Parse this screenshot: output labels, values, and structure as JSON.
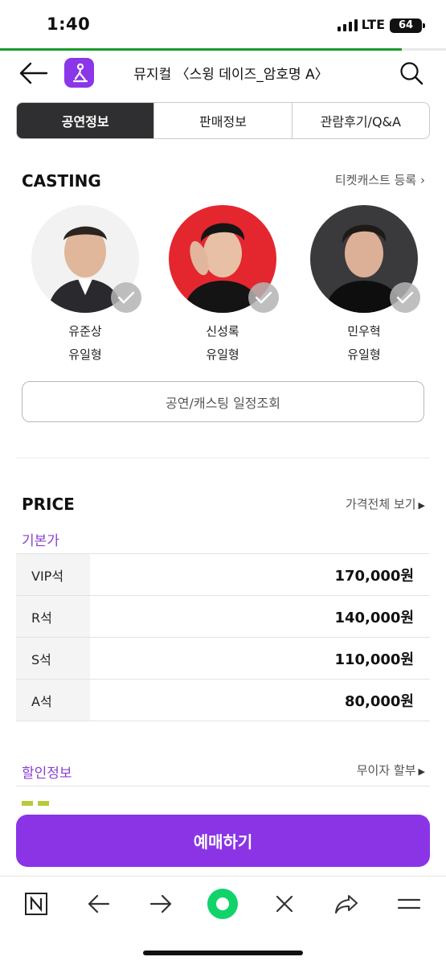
{
  "status_bar": {
    "time": "1:40",
    "network": "LTE",
    "battery": "64"
  },
  "header": {
    "title": "뮤지컬 〈스윙 데이즈_암호명 A〉"
  },
  "tabs": [
    {
      "label": "공연정보",
      "active": true
    },
    {
      "label": "판매정보",
      "active": false
    },
    {
      "label": "관람후기/Q&A",
      "active": false
    }
  ],
  "casting": {
    "heading": "CASTING",
    "link": "티켓캐스트 등록",
    "members": [
      {
        "name": "유준상",
        "role": "유일형",
        "icon": "check-icon"
      },
      {
        "name": "신성록",
        "role": "유일형",
        "icon": "check-icon"
      },
      {
        "name": "민우혁",
        "role": "유일형",
        "icon": "check-icon"
      }
    ],
    "schedule_button": "공연/캐스팅 일정조회"
  },
  "price": {
    "heading": "PRICE",
    "link": "가격전체 보기",
    "subheading": "기본가",
    "rows": [
      {
        "seat": "VIP석",
        "amount": "170,000원"
      },
      {
        "seat": "R석",
        "amount": "140,000원"
      },
      {
        "seat": "S석",
        "amount": "110,000원"
      },
      {
        "seat": "A석",
        "amount": "80,000원"
      }
    ]
  },
  "discount": {
    "heading": "할인정보",
    "link": "무이자 할부"
  },
  "cta": {
    "label": "예매하기"
  },
  "colors": {
    "accent": "#8a34e6",
    "tab_active": "#2f2f31",
    "progress": "#1a9b2c"
  },
  "browser_bar": [
    "naver-n-icon",
    "back-arrow-icon",
    "forward-arrow-icon",
    "green-home-icon",
    "close-icon",
    "share-icon",
    "menu-icon"
  ]
}
